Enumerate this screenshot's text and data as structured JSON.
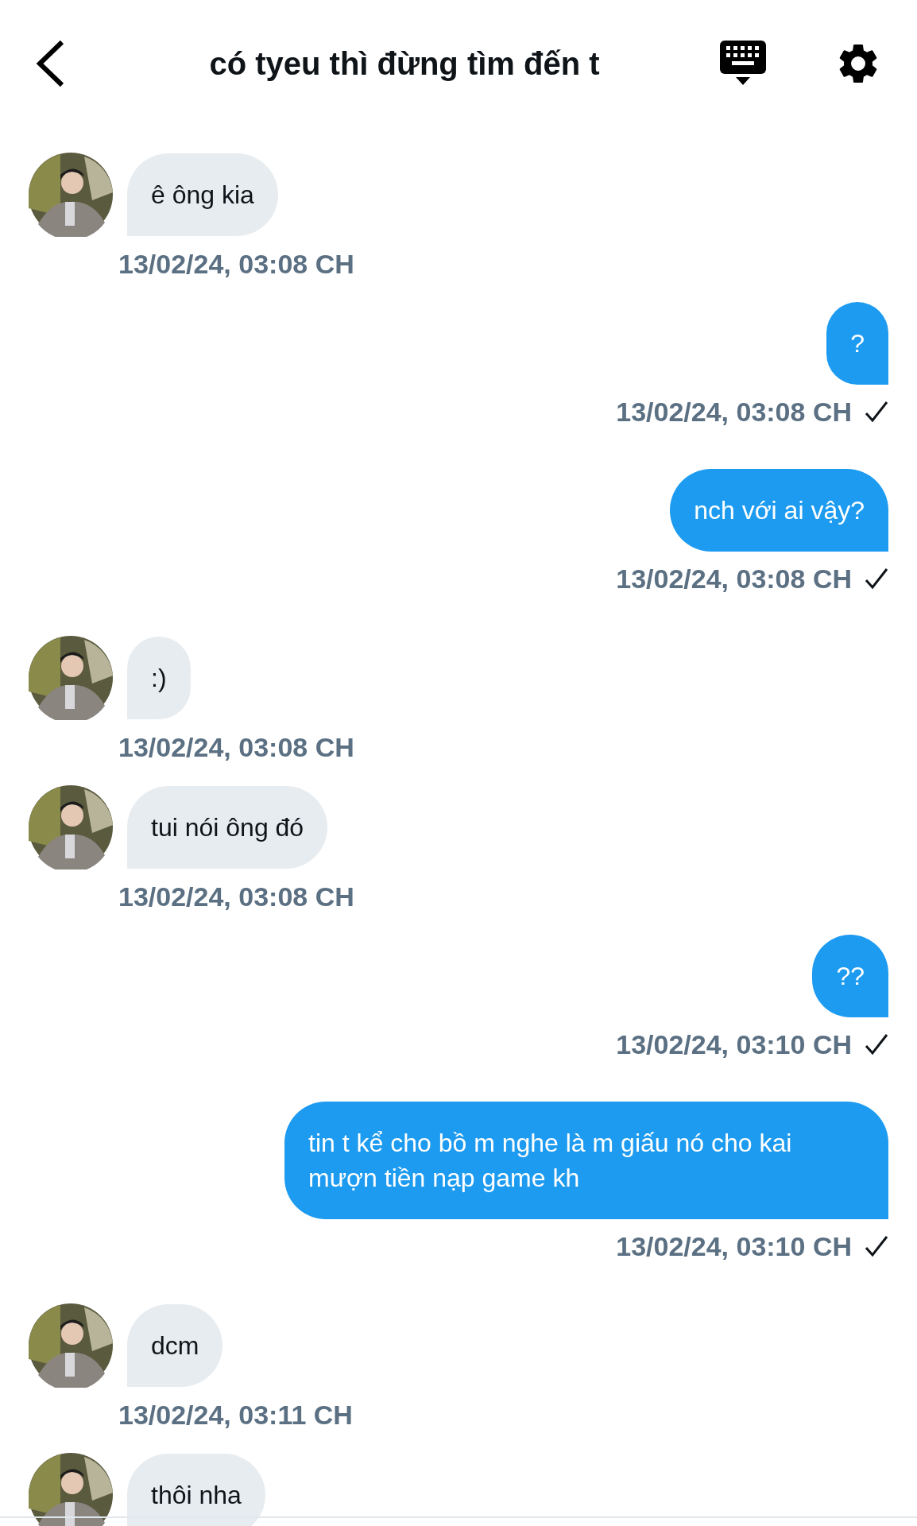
{
  "header": {
    "title": "có tyeu thì đừng tìm đến t"
  },
  "messages": [
    {
      "kind": "received",
      "text": "ê ông kia",
      "time": "13/02/24, 03:08 CH"
    },
    {
      "kind": "sent",
      "text": "?",
      "time": "13/02/24, 03:08 CH"
    },
    {
      "kind": "sent",
      "text": "nch với ai vậy?",
      "time": "13/02/24, 03:08 CH"
    },
    {
      "kind": "received",
      "text": ":)",
      "time": "13/02/24, 03:08 CH"
    },
    {
      "kind": "received",
      "text": "tui nói ông đó",
      "time": "13/02/24, 03:08 CH"
    },
    {
      "kind": "sent",
      "text": "??",
      "time": "13/02/24, 03:10 CH"
    },
    {
      "kind": "sent",
      "text": "tin t kể cho bồ m nghe là m giấu nó cho kai mượn tiền nạp game kh",
      "time": "13/02/24, 03:10 CH"
    },
    {
      "kind": "received",
      "text": "dcm",
      "time": "13/02/24, 03:11 CH"
    },
    {
      "kind": "received",
      "text": "thôi nha"
    }
  ]
}
